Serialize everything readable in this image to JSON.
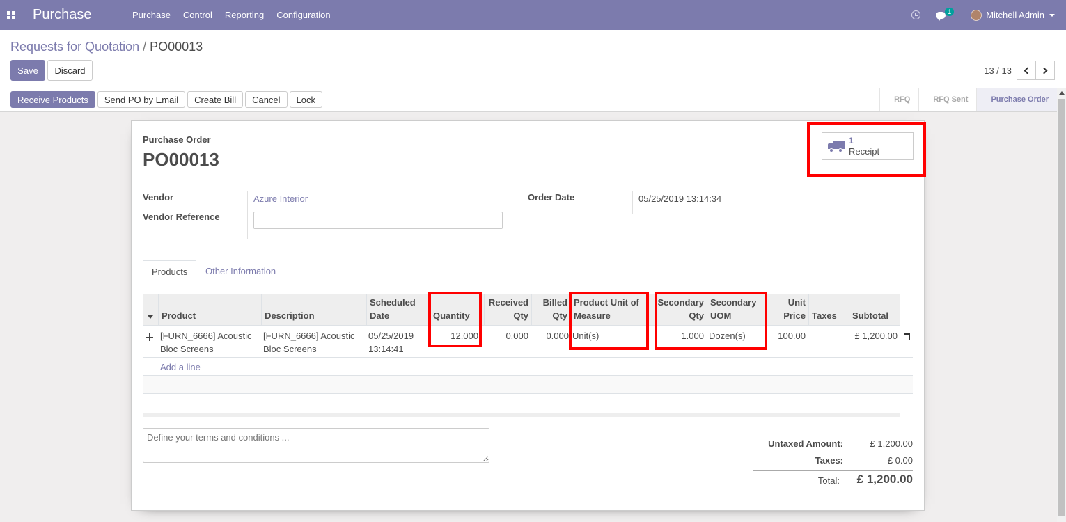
{
  "nav": {
    "brand": "Purchase",
    "menu": [
      "Purchase",
      "Control",
      "Reporting",
      "Configuration"
    ],
    "chat_badge": "1",
    "user_name": "Mitchell Admin"
  },
  "control_panel": {
    "breadcrumb_parent": "Requests for Quotation",
    "breadcrumb_sep": "/",
    "breadcrumb_current": "PO00013",
    "save_label": "Save",
    "discard_label": "Discard",
    "pager": "13 / 13"
  },
  "statusbar": {
    "actions": [
      "Receive Products",
      "Send PO by Email",
      "Create Bill",
      "Cancel",
      "Lock"
    ],
    "stages": [
      "RFQ",
      "RFQ Sent",
      "Purchase Order"
    ],
    "active_stage": "Purchase Order"
  },
  "sheet": {
    "smart_button": {
      "count": "1",
      "label": "Receipt"
    },
    "doc_label": "Purchase Order",
    "doc_name": "PO00013",
    "fields": {
      "vendor_label": "Vendor",
      "vendor_value": "Azure Interior",
      "vendor_ref_label": "Vendor Reference",
      "vendor_ref_value": "",
      "order_date_label": "Order Date",
      "order_date_value": "05/25/2019 13:14:34"
    },
    "tabs": [
      "Products",
      "Other Information"
    ],
    "table": {
      "headers": {
        "product": "Product",
        "description": "Description",
        "scheduled_date": "Scheduled Date",
        "quantity": "Quantity",
        "received_qty": "Received Qty",
        "billed_qty": "Billed Qty",
        "product_uom": "Product Unit of Measure",
        "secondary_qty": "Secondary Qty",
        "secondary_uom": "Secondary UOM",
        "unit_price": "Unit Price",
        "taxes": "Taxes",
        "subtotal": "Subtotal"
      },
      "rows": [
        {
          "product": "[FURN_6666] Acoustic Bloc Screens",
          "description": "[FURN_6666] Acoustic Bloc Screens",
          "scheduled_date": "05/25/2019 13:14:41",
          "quantity": "12.000",
          "received_qty": "0.000",
          "billed_qty": "0.000",
          "product_uom": "Unit(s)",
          "secondary_qty": "1.000",
          "secondary_uom": "Dozen(s)",
          "unit_price": "100.00",
          "taxes": "",
          "subtotal": "£ 1,200.00"
        }
      ],
      "add_line": "Add a line"
    },
    "terms_placeholder": "Define your terms and conditions ...",
    "totals": {
      "untaxed_label": "Untaxed Amount:",
      "untaxed_value": "£ 1,200.00",
      "taxes_label": "Taxes:",
      "taxes_value": "£ 0.00",
      "total_label": "Total:",
      "total_value": "£ 1,200.00"
    }
  },
  "colors": {
    "brand": "#7c7bad",
    "highlight": "#ff0000"
  }
}
